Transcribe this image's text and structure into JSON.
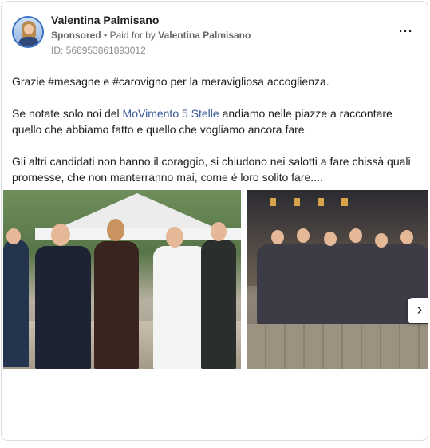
{
  "post": {
    "author": "Valentina Palmisano",
    "sponsored_label": "Sponsored",
    "separator": "•",
    "paid_prefix": "Paid for by",
    "paid_by": "Valentina Palmisano",
    "ad_id": "ID: 566953861893012",
    "more_icon": "more-horizontal-icon",
    "more_label": "···",
    "paragraphs": {
      "p1": "Grazie #mesagne e #carovigno per la meravigliosa accoglienza.",
      "p2_before": "Se notate solo noi del ",
      "p2_link": "MoVimento 5 Stelle",
      "p2_after": " andiamo nelle piazze a raccontare quello che abbiamo fatto e quello che vogliamo ancora fare.",
      "p3": "Gli altri candidati non hanno il coraggio, si chiudono nei salotti a fare chissà quali promesse, che non manterranno mai, come é loro solito fare...."
    },
    "carousel": {
      "next_icon": "chevron-right-icon",
      "next_label": "›"
    },
    "colors": {
      "link": "#385898",
      "text": "#1c1e21",
      "meta": "#65676b"
    }
  }
}
